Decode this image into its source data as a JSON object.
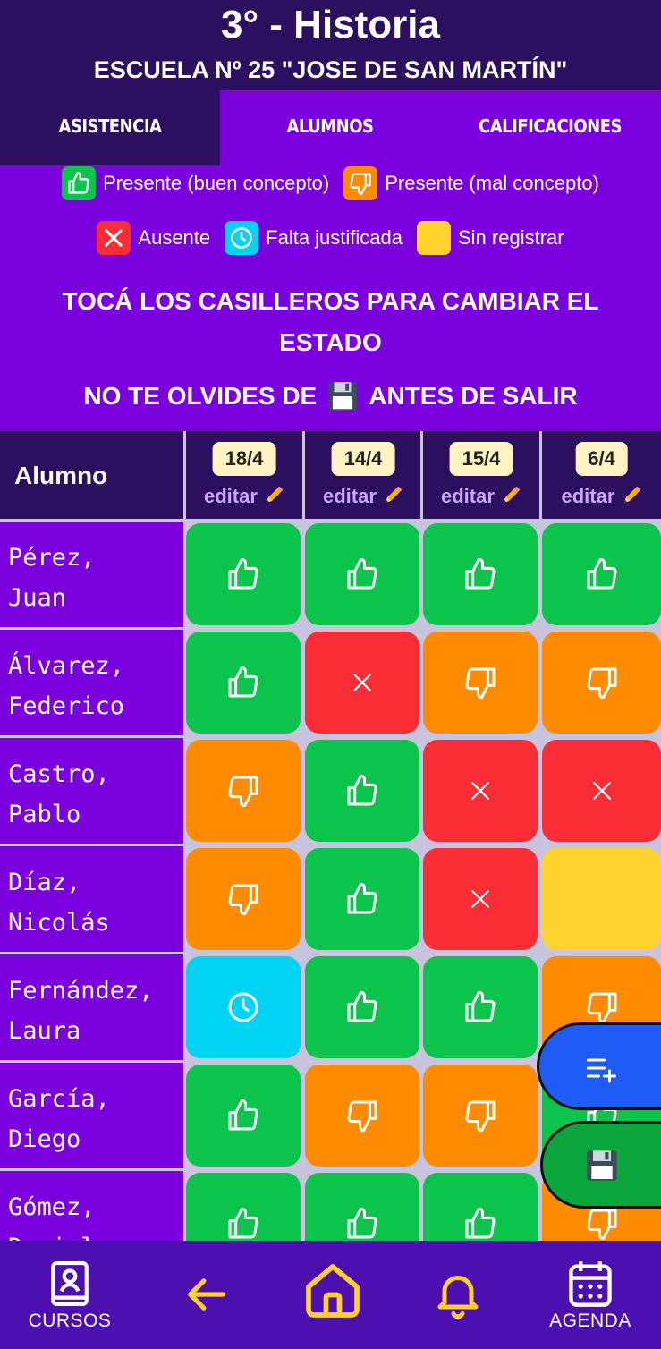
{
  "header": {
    "title": "3° - Historia",
    "school": "ESCUELA Nº 25 \"JOSE DE SAN MARTÍN\""
  },
  "tabs": [
    {
      "label": "ASISTENCIA",
      "active": true
    },
    {
      "label": "ALUMNOS",
      "active": false
    },
    {
      "label": "CALIFICACIONES",
      "active": false
    }
  ],
  "legend": {
    "present_good": "Presente (buen concepto)",
    "present_bad": "Presente (mal concepto)",
    "absent": "Ausente",
    "justified": "Falta justificada",
    "unregistered": "Sin registrar"
  },
  "instructions": {
    "line1": "TOCÁ LOS CASILLEROS PARA CAMBIAR EL ESTADO",
    "line2_pre": "NO TE OLVIDES DE",
    "line2_post": "ANTES DE SALIR"
  },
  "table": {
    "alumno_header": "Alumno",
    "edit_label": "editar",
    "dates": [
      "18/4",
      "14/4",
      "15/4",
      "6/4"
    ],
    "rows": [
      {
        "name1": "Pérez,",
        "name2": "Juan",
        "states": [
          "good",
          "good",
          "good",
          "good"
        ]
      },
      {
        "name1": "Álvarez,",
        "name2": "Federico",
        "states": [
          "good",
          "absent",
          "bad",
          "bad"
        ]
      },
      {
        "name1": "Castro,",
        "name2": "Pablo",
        "states": [
          "bad",
          "good",
          "absent",
          "absent"
        ]
      },
      {
        "name1": "Díaz,",
        "name2": "Nicolás",
        "states": [
          "bad",
          "good",
          "absent",
          "none"
        ]
      },
      {
        "name1": "Fernández,",
        "name2": "Laura",
        "states": [
          "justified",
          "good",
          "good",
          "bad"
        ]
      },
      {
        "name1": "García,",
        "name2": "Diego",
        "states": [
          "good",
          "bad",
          "bad",
          "good"
        ]
      },
      {
        "name1": "Gómez,",
        "name2": "Daniel",
        "states": [
          "good",
          "good",
          "good",
          "bad"
        ]
      }
    ]
  },
  "colors": {
    "good": "#0cc44c",
    "bad": "#ff8c00",
    "absent": "#fa2d36",
    "justified": "#00d4f2",
    "none": "#ffd22e",
    "header_bg": "#2c0f5e",
    "body_bg": "#7a00dd",
    "nav_bg": "#4d10b0",
    "nav_accent": "#ffcf2e"
  },
  "fabs": {
    "add_icon": "list-add-icon",
    "save_icon": "floppy-disk-icon"
  },
  "nav": {
    "courses": "CURSOS",
    "agenda": "AGENDA"
  }
}
